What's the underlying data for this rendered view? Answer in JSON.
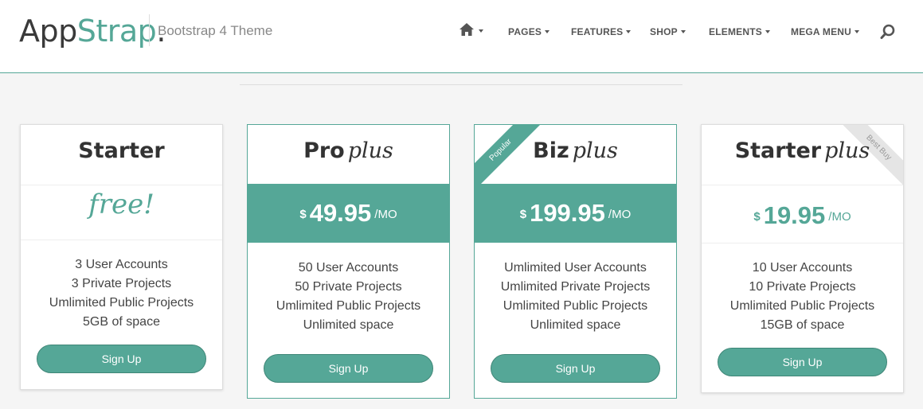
{
  "header": {
    "logo_app": "App",
    "logo_strap": "Strap",
    "logo_dot": ".",
    "tagline": "Bootstrap 4 Theme"
  },
  "nav": {
    "items": [
      {
        "label": "PAGES"
      },
      {
        "label": "FEATURES"
      },
      {
        "label": "SHOP"
      },
      {
        "label": "ELEMENTS"
      },
      {
        "label": "MEGA MENU"
      }
    ],
    "home_icon": "home-icon",
    "search_icon": "search-icon"
  },
  "plans": [
    {
      "title": "Starter",
      "plus": "",
      "free_text": "free!",
      "features": [
        "3 User Accounts",
        "3 Private Projects",
        "Umlimited Public Projects",
        "5GB of space"
      ],
      "button": "Sign Up"
    },
    {
      "title": "Pro",
      "plus": "plus",
      "currency": "$",
      "amount": "49.95",
      "period": "/MO",
      "features": [
        "50 User Accounts",
        "50 Private Projects",
        "Umlimited Public Projects",
        "Unlimited space"
      ],
      "button": "Sign Up"
    },
    {
      "title": "Biz",
      "plus": "plus",
      "ribbon": "Popular",
      "currency": "$",
      "amount": "199.95",
      "period": "/MO",
      "features": [
        "Umlimited User Accounts",
        "Umlimited Private Projects",
        "Umlimited Public Projects",
        "Unlimited space"
      ],
      "button": "Sign Up"
    },
    {
      "title": "Starter",
      "plus": "plus",
      "ribbon": "Best Buy",
      "currency": "$",
      "amount": "19.95",
      "period": "/MO",
      "features": [
        "10 User Accounts",
        "10 Private Projects",
        "Umlimited Public Projects",
        "15GB of space"
      ],
      "button": "Sign Up"
    }
  ],
  "colors": {
    "accent": "#55a797",
    "text": "#333333"
  }
}
